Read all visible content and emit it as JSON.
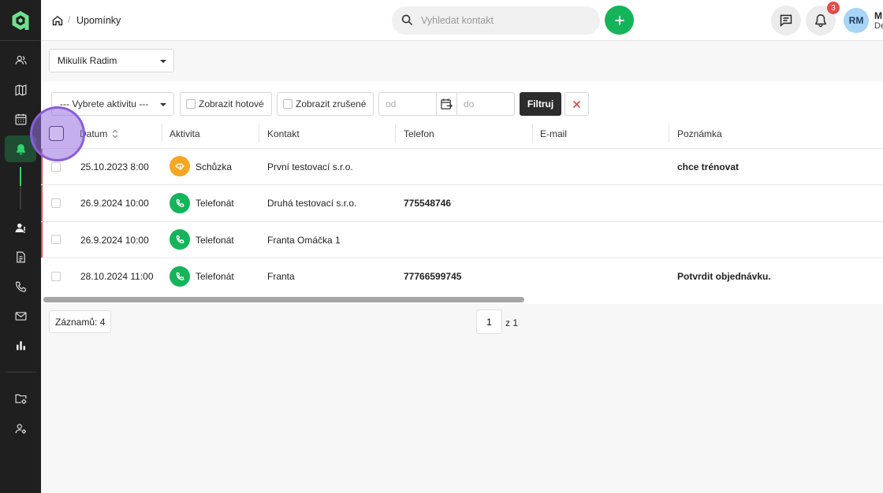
{
  "colors": {
    "sidebar": "#1f1f1f",
    "brand": "#16b45a",
    "active_bg": "#1e4d33",
    "overdue": "#e04a4a",
    "meeting": "#f5a623",
    "call": "#16b45a",
    "badge": "#e34b4b"
  },
  "sidebar": {
    "items": [
      {
        "icon": "users-icon"
      },
      {
        "icon": "map-icon"
      },
      {
        "icon": "calendar-icon"
      },
      {
        "icon": "bell-icon",
        "active": true
      },
      {
        "icon": "contact-icon"
      },
      {
        "icon": "document-icon"
      },
      {
        "icon": "phone-icon"
      },
      {
        "icon": "mail-icon"
      },
      {
        "icon": "chart-icon"
      },
      {
        "icon": "folder-settings-icon"
      },
      {
        "icon": "user-settings-icon"
      }
    ]
  },
  "header": {
    "breadcrumb_sep": "/",
    "breadcrumb_current": "Upomínky",
    "search_placeholder": "Vyhledat kontakt",
    "notifications_count": "3",
    "user_initials": "RM",
    "user_name": "M",
    "user_sub": "De"
  },
  "user_select": {
    "value": "Mikulík Radim"
  },
  "filters": {
    "activity_select": "--- Vybrete aktivitu ---",
    "show_done": "Zobrazit hotové",
    "show_cancelled": "Zobrazit zrušené",
    "date_from_placeholder": "od",
    "date_to_placeholder": "do",
    "filter_button": "Filtruj"
  },
  "table": {
    "columns": {
      "date": "Datum",
      "activity": "Aktivita",
      "contact": "Kontakt",
      "phone": "Telefon",
      "email": "E-mail",
      "note": "Poznámka"
    },
    "rows": [
      {
        "date": "25.10.2023 8:00",
        "activity": "Schůzka",
        "type": "meeting",
        "contact": "První testovací s.r.o.",
        "phone": "",
        "email": "",
        "note": "chce trénovat"
      },
      {
        "date": "26.9.2024 10:00",
        "activity": "Telefonát",
        "type": "call",
        "contact": "Druhá testovací s.r.o.",
        "phone": "775548746",
        "email": "",
        "note": ""
      },
      {
        "date": "26.9.2024 10:00",
        "activity": "Telefonát",
        "type": "call",
        "contact": "Franta Omáčka 1",
        "phone": "",
        "email": "",
        "note": ""
      },
      {
        "date": "28.10.2024 11:00",
        "activity": "Telefonát",
        "type": "call",
        "contact": "Franta",
        "phone": "77766599745",
        "email": "",
        "note": "Potvrdit objednávku."
      }
    ]
  },
  "footer": {
    "records": "Záznamů: 4",
    "page": "1",
    "page_of": "z 1"
  }
}
